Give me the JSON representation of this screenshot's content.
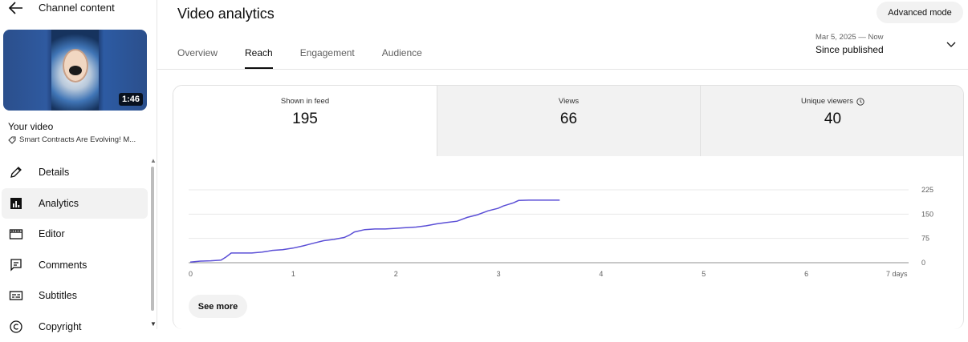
{
  "sidebar": {
    "header_title": "Channel content",
    "video": {
      "duration": "1:46",
      "heading": "Your video",
      "title": "Smart Contracts Are Evolving! M..."
    },
    "items": [
      {
        "label": "Details",
        "icon": "pencil-icon"
      },
      {
        "label": "Analytics",
        "icon": "analytics-icon"
      },
      {
        "label": "Editor",
        "icon": "film-icon"
      },
      {
        "label": "Comments",
        "icon": "comment-icon"
      },
      {
        "label": "Subtitles",
        "icon": "subtitles-icon"
      },
      {
        "label": "Copyright",
        "icon": "copyright-icon"
      }
    ],
    "active_item": "Analytics"
  },
  "header": {
    "title": "Video analytics",
    "advanced_label": "Advanced mode"
  },
  "tabs": [
    {
      "label": "Overview"
    },
    {
      "label": "Reach"
    },
    {
      "label": "Engagement"
    },
    {
      "label": "Audience"
    }
  ],
  "active_tab": "Reach",
  "date_range": {
    "range": "Mar 5, 2025 — Now",
    "label": "Since published"
  },
  "metrics": [
    {
      "label": "Shown in feed",
      "value": "195"
    },
    {
      "label": "Views",
      "value": "66"
    },
    {
      "label": "Unique viewers",
      "value": "40",
      "icon": "clock-icon"
    }
  ],
  "colors": {
    "line": "#5b4fd6",
    "accent": "#0f0f0f"
  },
  "chart_data": {
    "type": "line",
    "x_ticks": [
      "0",
      "1",
      "2",
      "3",
      "4",
      "5",
      "6",
      "7 days"
    ],
    "y_ticks": [
      "0",
      "75",
      "150",
      "225"
    ],
    "xlim": [
      0,
      7
    ],
    "ylim": [
      0,
      225
    ],
    "grid": true,
    "series": [
      {
        "x": [
          0,
          0.1,
          0.2,
          0.3,
          0.35,
          0.4,
          0.5,
          0.6,
          0.7,
          0.75,
          0.8,
          0.9,
          1.0,
          1.1,
          1.2,
          1.3,
          1.4,
          1.5,
          1.55,
          1.6,
          1.7,
          1.8,
          1.9,
          2.0,
          2.1,
          2.2,
          2.3,
          2.4,
          2.5,
          2.6,
          2.7,
          2.8,
          2.9,
          3.0,
          3.05,
          3.1,
          3.15,
          3.2,
          3.3,
          3.4,
          3.5,
          3.6
        ],
        "y": [
          2,
          5,
          6,
          8,
          18,
          30,
          30,
          30,
          33,
          35,
          38,
          40,
          45,
          52,
          60,
          68,
          72,
          78,
          85,
          95,
          102,
          104,
          104,
          106,
          108,
          110,
          114,
          120,
          124,
          128,
          140,
          148,
          160,
          168,
          175,
          180,
          185,
          192,
          193,
          193,
          193,
          193
        ]
      }
    ]
  },
  "see_more_label": "See more"
}
